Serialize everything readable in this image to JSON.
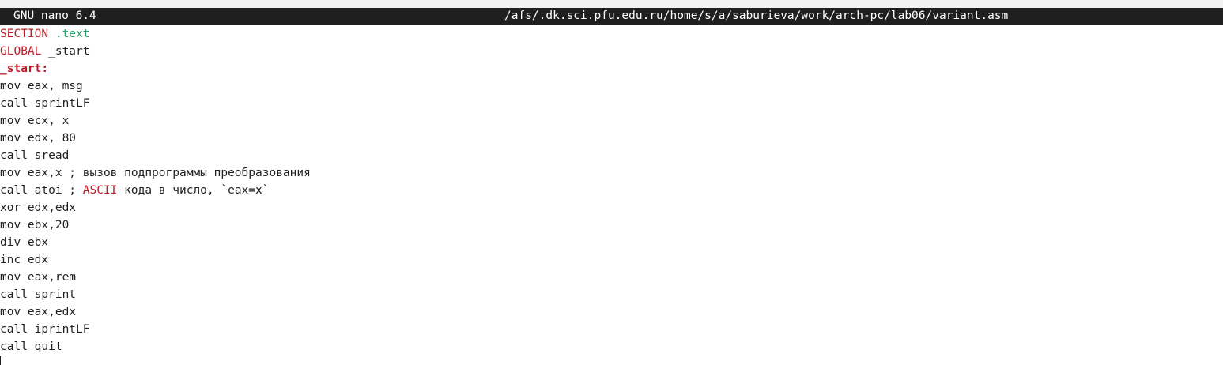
{
  "titlebar": {
    "app": "GNU nano 6.4",
    "path": "/afs/.dk.sci.pfu.edu.ru/home/s/a/saburieva/work/arch-pc/lab06/variant.asm"
  },
  "lines": {
    "l1": {
      "a": "SECTION",
      "b": " .text"
    },
    "l2": {
      "a": "GLOBAL",
      "b": " _start"
    },
    "l3": {
      "a": "_start:"
    },
    "l4": "mov eax, msg",
    "l5": "call sprintLF",
    "l6": "mov ecx, x",
    "l7": "mov edx, 80",
    "l8": "call sread",
    "l9": "mov eax,x ; вызов подпрограммы преобразования",
    "l10": {
      "a": "call atoi ; ",
      "b": "ASCII",
      "c": " кода в число, `eax=x`"
    },
    "l11": "xor edx,edx",
    "l12": "mov ebx,20",
    "l13": "div ebx",
    "l14": "inc edx",
    "l15": "mov eax,rem",
    "l16": "call sprint",
    "l17": "mov eax,edx",
    "l18": "call iprintLF",
    "l19": "call quit"
  },
  "colors": {
    "keyword": "#c01c28",
    "section_name": "#26a269",
    "titlebar_bg": "#1f1f1f"
  }
}
